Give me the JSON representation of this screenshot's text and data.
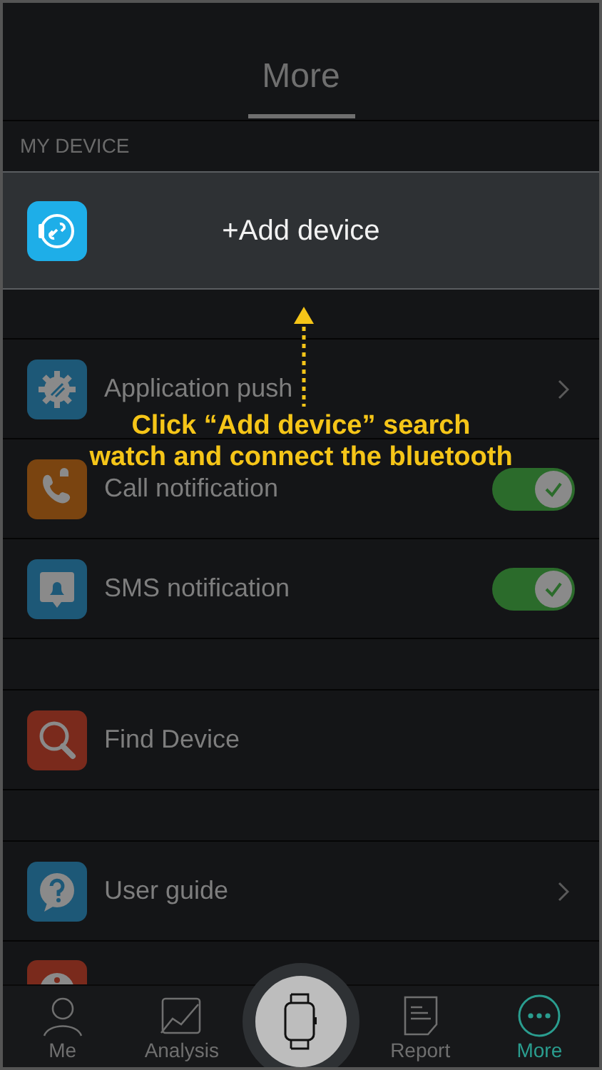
{
  "header": {
    "title": "More"
  },
  "section_label": "MY DEVICE",
  "add_device": {
    "label": "+Add device"
  },
  "groups": [
    [
      {
        "kind": "link",
        "label": "Application push"
      },
      {
        "kind": "toggle",
        "label": "Call notification",
        "on": true
      },
      {
        "kind": "toggle",
        "label": "SMS notification",
        "on": true
      }
    ],
    [
      {
        "kind": "plain",
        "label": "Find Device"
      }
    ],
    [
      {
        "kind": "link",
        "label": "User guide"
      },
      {
        "kind": "cut"
      }
    ]
  ],
  "tutorial": {
    "lines": [
      "Click “Add device” search",
      "watch and connect the bluetooth"
    ]
  },
  "nav": [
    {
      "kind": "tab",
      "label": "Me",
      "selected": false
    },
    {
      "kind": "tab",
      "label": "Analysis",
      "selected": false
    },
    {
      "kind": "center"
    },
    {
      "kind": "tab",
      "label": "Report",
      "selected": false
    },
    {
      "kind": "tab",
      "label": "More",
      "selected": true
    }
  ]
}
